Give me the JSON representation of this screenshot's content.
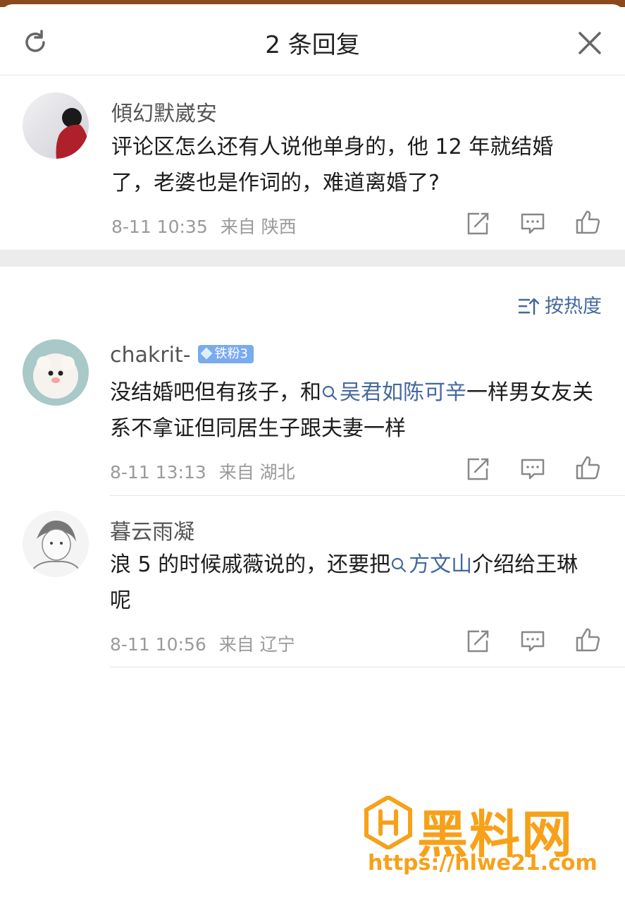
{
  "header": {
    "title": "2 条回复"
  },
  "main_comment": {
    "author": "傾幻默崴安",
    "text": "评论区怎么还有人说他单身的，他 12 年就结婚了，老婆也是作词的，难道离婚了?",
    "time": "8-11 10:35",
    "location": "来自 陕西"
  },
  "sort": {
    "label": "按热度"
  },
  "replies": [
    {
      "author": "chakrit-",
      "badge": "铁粉3",
      "text_before": "没结婚吧但有孩子，和",
      "topic": "吴君如陈可辛",
      "text_after": "一样男女友关系不拿证但同居生子跟夫妻一样",
      "time": "8-11 13:13",
      "location": "来自 湖北"
    },
    {
      "author": "暮云雨凝",
      "text_before": "浪 5 的时候戚薇说的，还要把",
      "topic": "方文山",
      "text_after": "介绍给王琳呢",
      "time": "8-11 10:56",
      "location": "来自 辽宁"
    }
  ],
  "watermark": {
    "title": "黑料网",
    "url": "https://hlwe21.com"
  },
  "colors": {
    "link": "#44689e",
    "watermark": "#f7a11a"
  }
}
